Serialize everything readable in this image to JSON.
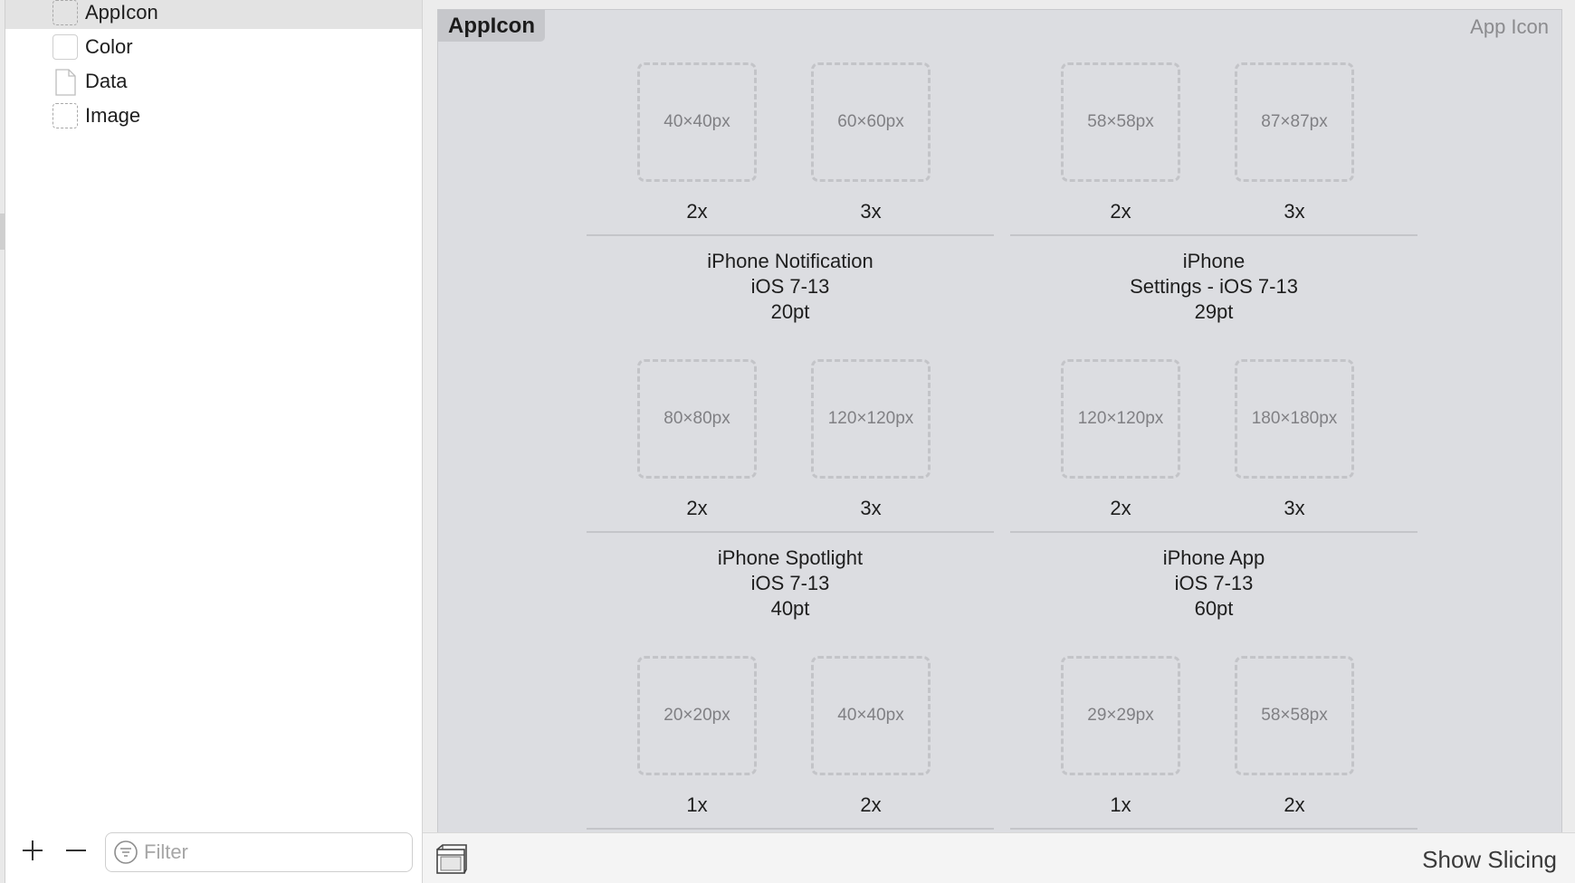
{
  "sidebar": {
    "items": [
      {
        "label": "AppIcon",
        "icon": "appicon-icon",
        "selected": true
      },
      {
        "label": "Color",
        "icon": "color-set-icon",
        "selected": false
      },
      {
        "label": "Data",
        "icon": "data-file-icon",
        "selected": false
      },
      {
        "label": "Image",
        "icon": "image-set-icon",
        "selected": false
      }
    ],
    "add_icon": "plus-icon",
    "remove_icon": "minus-icon",
    "filter": {
      "placeholder": "Filter",
      "value": "",
      "icon": "filter-icon"
    }
  },
  "editor": {
    "set_name": "AppIcon",
    "set_kind": "App Icon",
    "groups": [
      {
        "name": "iPhone Notification",
        "line2": "iOS 7-13",
        "line3": "20pt",
        "slots": [
          {
            "size": "40×40px",
            "scale": "2x"
          },
          {
            "size": "60×60px",
            "scale": "3x"
          }
        ]
      },
      {
        "name": "iPhone",
        "line2": "Settings - iOS 7-13",
        "line3": "29pt",
        "slots": [
          {
            "size": "58×58px",
            "scale": "2x"
          },
          {
            "size": "87×87px",
            "scale": "3x"
          }
        ]
      },
      {
        "name": "iPhone Spotlight",
        "line2": "iOS 7-13",
        "line3": "40pt",
        "slots": [
          {
            "size": "80×80px",
            "scale": "2x"
          },
          {
            "size": "120×120px",
            "scale": "3x"
          }
        ]
      },
      {
        "name": "iPhone App",
        "line2": "iOS 7-13",
        "line3": "60pt",
        "slots": [
          {
            "size": "120×120px",
            "scale": "2x"
          },
          {
            "size": "180×180px",
            "scale": "3x"
          }
        ]
      },
      {
        "name": "",
        "line2": "",
        "line3": "",
        "slots": [
          {
            "size": "20×20px",
            "scale": "1x"
          },
          {
            "size": "40×40px",
            "scale": "2x"
          }
        ]
      },
      {
        "name": "",
        "line2": "",
        "line3": "",
        "slots": [
          {
            "size": "29×29px",
            "scale": "1x"
          },
          {
            "size": "58×58px",
            "scale": "2x"
          }
        ]
      }
    ]
  },
  "bottom_bar": {
    "slicing_icon": "slicing-toggle-icon",
    "show_slicing_label": "Show Slicing"
  },
  "colors": {
    "canvas_bg": "#dcdde1",
    "sidebar_selected": "#e3e3e3",
    "well_border": "#c3c4c8"
  }
}
